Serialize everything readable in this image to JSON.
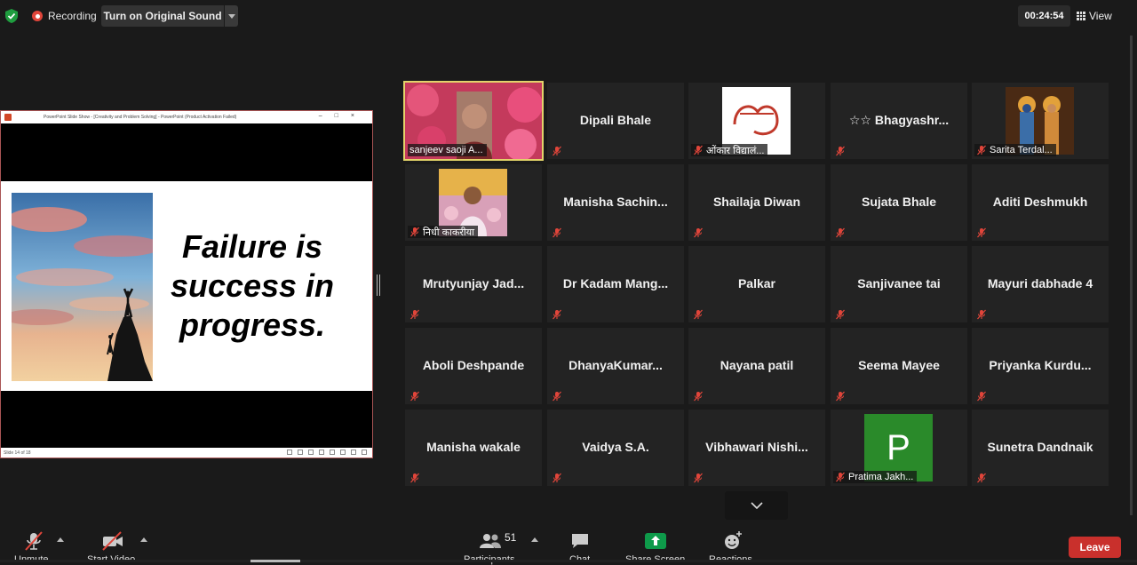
{
  "top": {
    "recording": "Recording",
    "original_sound": "Turn on Original Sound",
    "timer": "00:24:54",
    "view": "View"
  },
  "share": {
    "window_title": "PowerPoint Slide Show - [Creativity and Problem Solving] - PowerPoint (Product Activation Failed)",
    "slide_text": [
      "Failure is",
      "success in",
      "progress."
    ],
    "slide_status": "Slide 14 of 18"
  },
  "tiles": [
    {
      "type": "video",
      "label": "sanjeev saoji  A..."
    },
    {
      "type": "name",
      "name": "Dipali Bhale"
    },
    {
      "type": "image",
      "label": "ओंकार  विद्यालं..."
    },
    {
      "type": "name",
      "name": "☆☆  Bhagyashr..."
    },
    {
      "type": "image",
      "label": "Sarita Terdal..."
    },
    {
      "type": "image",
      "label": "निधी  काकरीया"
    },
    {
      "type": "name",
      "name": "Manisha  Sachin..."
    },
    {
      "type": "name",
      "name": "Shailaja Diwan"
    },
    {
      "type": "name",
      "name": "Sujata Bhale"
    },
    {
      "type": "name",
      "name": "Aditi Deshmukh"
    },
    {
      "type": "name",
      "name": "Mrutyunjay  Jad..."
    },
    {
      "type": "name",
      "name": "Dr Kadam Mang..."
    },
    {
      "type": "name",
      "name": "Palkar"
    },
    {
      "type": "name",
      "name": "Sanjivanee tai"
    },
    {
      "type": "name",
      "name": "Mayuri dabhade 4"
    },
    {
      "type": "name",
      "name": "Aboli Deshpande"
    },
    {
      "type": "name",
      "name": "DhanyaKumar..."
    },
    {
      "type": "name",
      "name": "Nayana  patil"
    },
    {
      "type": "name",
      "name": "Seema Mayee"
    },
    {
      "type": "name",
      "name": "Priyanka  Kurdu..."
    },
    {
      "type": "name",
      "name": "Manisha wakale"
    },
    {
      "type": "name",
      "name": "Vaidya S.A."
    },
    {
      "type": "name",
      "name": "Vibhawari  Nishi..."
    },
    {
      "type": "avatar",
      "initial": "P",
      "label": "Pratima Jakh..."
    },
    {
      "type": "name",
      "name": "Sunetra Dandnaik"
    }
  ],
  "toolbar": {
    "participants_count": "51",
    "leave": "Leave",
    "labels": [
      "Unmute",
      "Start Video",
      "Participants",
      "Chat",
      "Share Screen",
      "Reactions"
    ]
  },
  "colors": {
    "active_speaker": "#e3d36a",
    "leave": "#c9302c",
    "share_green": "#0e9a4a",
    "mute_red": "#e0453a"
  }
}
